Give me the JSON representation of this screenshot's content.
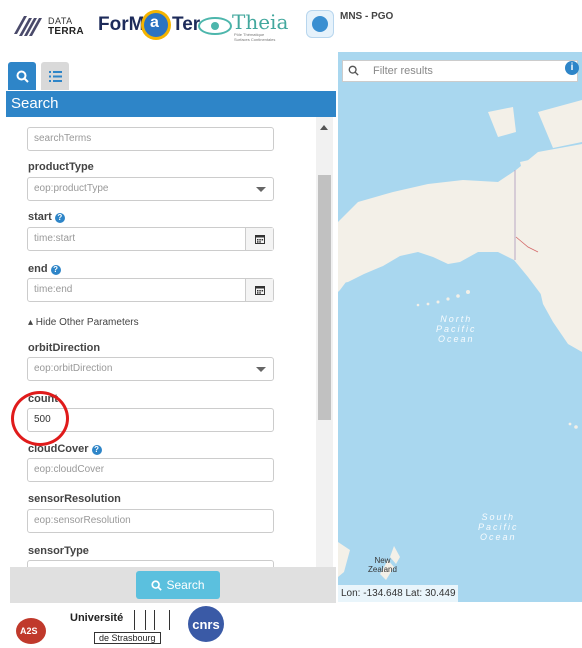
{
  "header": {
    "logos": {
      "dataterra_top": "DATA",
      "dataterra_bottom": "TERRA",
      "formater_left": "ForM",
      "formater_mid": "a",
      "formater_right": "Ter",
      "theia": "Theia",
      "theia_sub": "Pôle Thématique Surfaces Continentales"
    },
    "app_title": "MNS - PGO"
  },
  "tabs": [
    {
      "label": "search-tab",
      "icon": "search-icon",
      "active": true
    },
    {
      "label": "list-tab",
      "icon": "list-icon",
      "active": false
    }
  ],
  "panel": {
    "title": "Search",
    "fields": {
      "searchTerms": {
        "placeholder": "searchTerms"
      },
      "productType": {
        "label": "productType",
        "placeholder": "eop:productType"
      },
      "start": {
        "label": "start",
        "placeholder": "time:start"
      },
      "end": {
        "label": "end",
        "placeholder": "time:end"
      },
      "toggle": "▴ Hide Other Parameters",
      "orbitDirection": {
        "label": "orbitDirection",
        "placeholder": "eop:orbitDirection"
      },
      "count": {
        "label": "count",
        "value": "500"
      },
      "cloudCover": {
        "label": "cloudCover",
        "placeholder": "eop:cloudCover"
      },
      "sensorResolution": {
        "label": "sensorResolution",
        "placeholder": "eop:sensorResolution"
      },
      "sensorType": {
        "label": "sensorType"
      }
    },
    "search_button": "Search"
  },
  "map": {
    "filter_placeholder": "Filter results",
    "coords": "Lon: -134.648 Lat: 30.449",
    "labels": {
      "north_pacific_1": "North",
      "north_pacific_2": "Pacific",
      "north_pacific_3": "Ocean",
      "south_pacific_1": "South",
      "south_pacific_2": "Pacific",
      "south_pacific_3": "Ocean",
      "nz_1": "New",
      "nz_2": "Zealand"
    }
  },
  "footer": {
    "a2s": "A2S",
    "unistra_1": "Université",
    "unistra_2": "de Strasbourg",
    "cnrs": "cnrs"
  },
  "colors": {
    "accent": "#2e85c8",
    "search_button": "#5bc0de",
    "highlight": "#e01b1b",
    "ocean": "#a9d7ef"
  }
}
